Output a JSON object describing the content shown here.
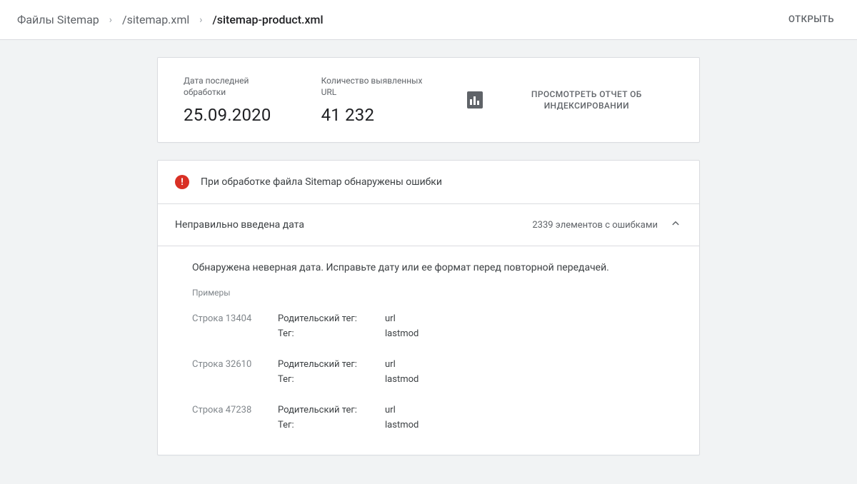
{
  "breadcrumb": {
    "root": "Файлы Sitemap",
    "middle": "/sitemap.xml",
    "current": "/sitemap-product.xml"
  },
  "open_label": "ОТКРЫТЬ",
  "stats": {
    "date_label": "Дата последней обработки",
    "date_value": "25.09.2020",
    "url_label": "Количество выявленных URL",
    "url_value": "41 232",
    "report_label": "ПРОСМОТРЕТЬ ОТЧЕТ ОБ ИНДЕКСИРОВАНИИ"
  },
  "error": {
    "title": "При обработке файла Sitemap обнаружены ошибки",
    "accordion_label": "Неправильно введена дата",
    "count_text": "2339 элементов с ошибками",
    "description": "Обнаружена неверная дата. Исправьте дату или ее формат перед повторной передачей.",
    "examples_label": "Примеры",
    "line_prefix": "Строка",
    "parent_tag_label": "Родительский тег:",
    "tag_label": "Тег:",
    "examples": [
      {
        "line": "13404",
        "parent": "url",
        "tag": "lastmod"
      },
      {
        "line": "32610",
        "parent": "url",
        "tag": "lastmod"
      },
      {
        "line": "47238",
        "parent": "url",
        "tag": "lastmod"
      }
    ]
  }
}
